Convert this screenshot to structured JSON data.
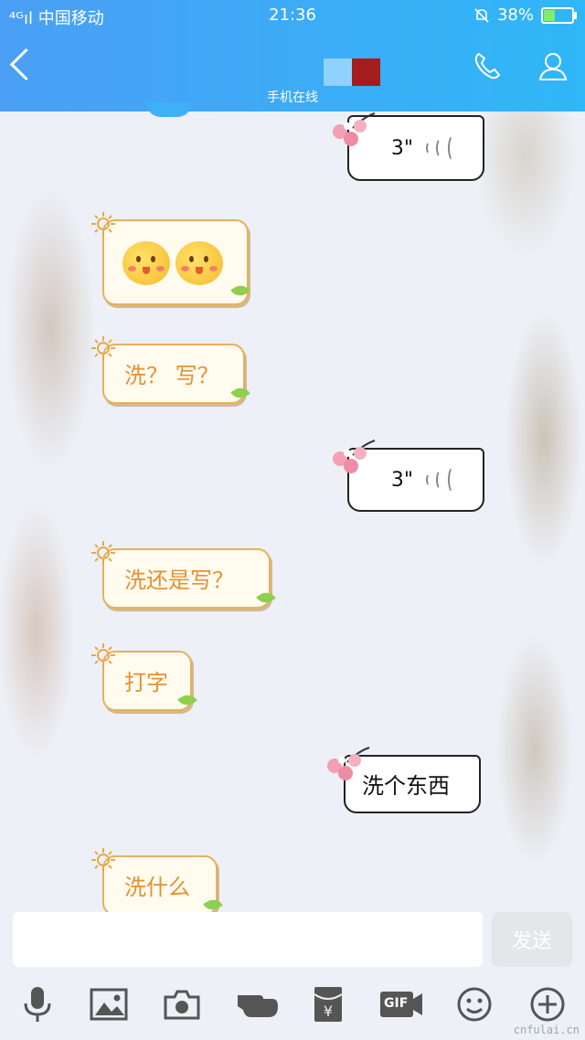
{
  "status_bar": {
    "carrier": "⁴ᴳıl 中国移动",
    "time": "21:36",
    "battery": "38%"
  },
  "header": {
    "subtitle": "手机在线"
  },
  "messages": [
    {
      "side": "right",
      "type": "voice",
      "duration": "3\""
    },
    {
      "side": "left",
      "type": "emoji"
    },
    {
      "side": "left",
      "type": "text",
      "text": "洗？ 写？"
    },
    {
      "side": "right",
      "type": "voice",
      "duration": "3\""
    },
    {
      "side": "left",
      "type": "text",
      "text": "洗还是写？"
    },
    {
      "side": "left",
      "type": "text",
      "text": "打字"
    },
    {
      "side": "right",
      "type": "text",
      "text": "洗个东西"
    },
    {
      "side": "left",
      "type": "text",
      "text": "洗什么"
    }
  ],
  "composer": {
    "send_label": "发送"
  },
  "toolbar": {
    "gif_label": "GIF"
  },
  "watermark": "cnfulai.cn",
  "colors": {
    "header_start": "#4b9ff5",
    "header_end": "#2fb7f7",
    "left_text": "#e49132"
  }
}
